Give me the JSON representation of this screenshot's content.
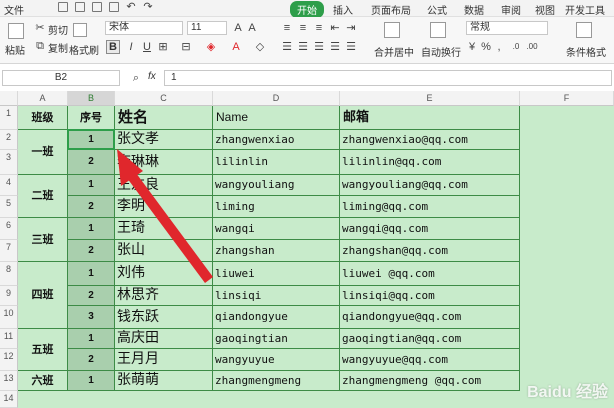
{
  "menu": {
    "file_label": "文件",
    "tabs": [
      {
        "label": "开始",
        "active": true
      },
      {
        "label": "插入",
        "active": false
      },
      {
        "label": "页面布局",
        "active": false
      },
      {
        "label": "公式",
        "active": false
      },
      {
        "label": "数据",
        "active": false
      },
      {
        "label": "审阅",
        "active": false
      },
      {
        "label": "视图",
        "active": false
      },
      {
        "label": "开发工具",
        "active": false
      }
    ]
  },
  "ribbon": {
    "paste": "粘贴",
    "cut": "剪切",
    "copy": "复制",
    "format_painter": "格式刷",
    "font_name": "宋体",
    "font_size": "11",
    "merge_center": "合并居中",
    "wrap_text": "自动换行",
    "number_format": "常规",
    "conditional_format": "条件格式"
  },
  "formula_bar": {
    "cell_ref": "B2",
    "fx_label": "fx",
    "value": "1"
  },
  "columns": [
    "A",
    "B",
    "C",
    "D",
    "E",
    "F"
  ],
  "rows": [
    "1",
    "2",
    "3",
    "4",
    "5",
    "6",
    "7",
    "8",
    "9",
    "10",
    "11",
    "12",
    "13",
    "14"
  ],
  "table": {
    "headers": {
      "class": "班级",
      "seq": "序号",
      "name": "姓名",
      "pinyin": "Name",
      "email": "邮箱"
    },
    "groups": [
      {
        "class": "一班",
        "rows": [
          {
            "seq": "1",
            "name": "张文孝",
            "pinyin": "zhangwenxiao",
            "email": "zhangwenxiao@qq.com"
          },
          {
            "seq": "2",
            "name": "李琳琳",
            "pinyin": "lilinlin",
            "email": "lilinlin@qq.com"
          }
        ]
      },
      {
        "class": "二班",
        "rows": [
          {
            "seq": "1",
            "name": "王友良",
            "pinyin": "wangyouliang",
            "email": "wangyouliang@qq.com"
          },
          {
            "seq": "2",
            "name": "李明",
            "pinyin": "liming",
            "email": "liming@qq.com"
          }
        ]
      },
      {
        "class": "三班",
        "rows": [
          {
            "seq": "1",
            "name": "王琦",
            "pinyin": "wangqi",
            "email": "wangqi@qq.com"
          },
          {
            "seq": "2",
            "name": "张山",
            "pinyin": "zhangshan",
            "email": "zhangshan@qq.com"
          }
        ]
      },
      {
        "class": "四班",
        "rows": [
          {
            "seq": "1",
            "name": "刘伟",
            "pinyin": "liuwei",
            "email": "liuwei @qq.com"
          },
          {
            "seq": "2",
            "name": "林思齐",
            "pinyin": "linsiqi",
            "email": "linsiqi@qq.com"
          },
          {
            "seq": "3",
            "name": "钱东跃",
            "pinyin": "qiandongyue",
            "email": "qiandongyue@qq.com"
          }
        ]
      },
      {
        "class": "五班",
        "rows": [
          {
            "seq": "1",
            "name": "高庆田",
            "pinyin": "gaoqingtian",
            "email": "gaoqingtian@qq.com"
          },
          {
            "seq": "2",
            "name": "王月月",
            "pinyin": "wangyuyue",
            "email": "wangyuyue@qq.com"
          }
        ]
      },
      {
        "class": "六班",
        "rows": [
          {
            "seq": "1",
            "name": "张萌萌",
            "pinyin": "zhangmengmeng",
            "email": "zhangmengmeng @qq.com"
          }
        ]
      }
    ]
  },
  "watermark": "Baidu 经验",
  "colors": {
    "accent": "#2e9e4a",
    "sheet_fill": "#c8ebcb",
    "seq_fill": "#a9cfad",
    "arrow": "#e0272c"
  }
}
